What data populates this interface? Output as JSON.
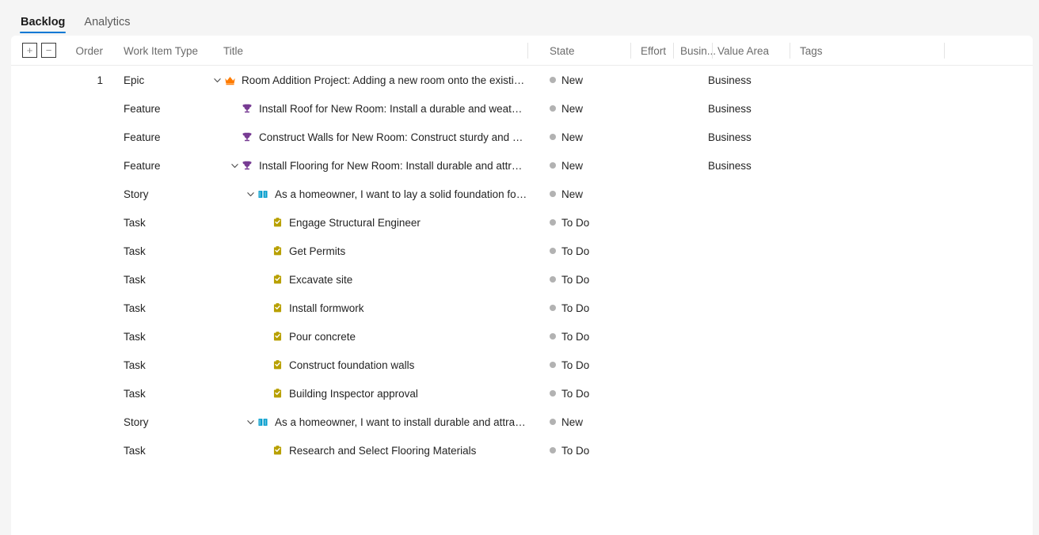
{
  "tabs": [
    {
      "label": "Backlog",
      "active": true
    },
    {
      "label": "Analytics",
      "active": false
    }
  ],
  "toolbar": {
    "expand_all_label": "+",
    "collapse_all_label": "−"
  },
  "columns": [
    {
      "key": "order",
      "label": "Order"
    },
    {
      "key": "type",
      "label": "Work Item Type"
    },
    {
      "key": "title",
      "label": "Title"
    },
    {
      "key": "state",
      "label": "State"
    },
    {
      "key": "effort",
      "label": "Effort"
    },
    {
      "key": "biz",
      "label": "Busin..."
    },
    {
      "key": "value",
      "label": "Value Area"
    },
    {
      "key": "tags",
      "label": "Tags"
    }
  ],
  "colors": {
    "accent": "#0078d4",
    "epic": "#ff7b00",
    "feature": "#773b93",
    "story": "#009ccc",
    "task": "#b8a000",
    "state_dot": "#b2b2b2"
  },
  "rows": [
    {
      "order": "1",
      "type": "Epic",
      "icon": "crown-icon",
      "indent": 0,
      "chevron": "down",
      "title": "Room Addition Project: Adding a new room onto the existin...",
      "state": "New",
      "effort": "",
      "biz": "",
      "value": "Business",
      "tags": ""
    },
    {
      "order": "",
      "type": "Feature",
      "icon": "trophy-icon",
      "indent": 1,
      "chevron": "none",
      "title": "Install Roof for New Room: Install a durable and weather...",
      "state": "New",
      "effort": "",
      "biz": "",
      "value": "Business",
      "tags": ""
    },
    {
      "order": "",
      "type": "Feature",
      "icon": "trophy-icon",
      "indent": 1,
      "chevron": "none",
      "title": "Construct Walls for New Room: Construct sturdy and wel...",
      "state": "New",
      "effort": "",
      "biz": "",
      "value": "Business",
      "tags": ""
    },
    {
      "order": "",
      "type": "Feature",
      "icon": "trophy-icon",
      "indent": 1,
      "chevron": "down",
      "title": "Install Flooring for New Room: Install durable and attracti...",
      "state": "New",
      "effort": "",
      "biz": "",
      "value": "Business",
      "tags": ""
    },
    {
      "order": "",
      "type": "Story",
      "icon": "book-icon",
      "indent": 2,
      "chevron": "down",
      "title": "As a homeowner, I want to lay a solid foundation for t...",
      "state": "New",
      "effort": "",
      "biz": "",
      "value": "",
      "tags": ""
    },
    {
      "order": "",
      "type": "Task",
      "icon": "clipboard-icon",
      "indent": 3,
      "chevron": "none",
      "title": "Engage Structural Engineer",
      "state": "To Do",
      "effort": "",
      "biz": "",
      "value": "",
      "tags": ""
    },
    {
      "order": "",
      "type": "Task",
      "icon": "clipboard-icon",
      "indent": 3,
      "chevron": "none",
      "title": "Get Permits",
      "state": "To Do",
      "effort": "",
      "biz": "",
      "value": "",
      "tags": ""
    },
    {
      "order": "",
      "type": "Task",
      "icon": "clipboard-icon",
      "indent": 3,
      "chevron": "none",
      "title": "Excavate site",
      "state": "To Do",
      "effort": "",
      "biz": "",
      "value": "",
      "tags": ""
    },
    {
      "order": "",
      "type": "Task",
      "icon": "clipboard-icon",
      "indent": 3,
      "chevron": "none",
      "title": "Install formwork",
      "state": "To Do",
      "effort": "",
      "biz": "",
      "value": "",
      "tags": ""
    },
    {
      "order": "",
      "type": "Task",
      "icon": "clipboard-icon",
      "indent": 3,
      "chevron": "none",
      "title": "Pour concrete",
      "state": "To Do",
      "effort": "",
      "biz": "",
      "value": "",
      "tags": ""
    },
    {
      "order": "",
      "type": "Task",
      "icon": "clipboard-icon",
      "indent": 3,
      "chevron": "none",
      "title": "Construct foundation walls",
      "state": "To Do",
      "effort": "",
      "biz": "",
      "value": "",
      "tags": ""
    },
    {
      "order": "",
      "type": "Task",
      "icon": "clipboard-icon",
      "indent": 3,
      "chevron": "none",
      "title": "Building Inspector approval",
      "state": "To Do",
      "effort": "",
      "biz": "",
      "value": "",
      "tags": ""
    },
    {
      "order": "",
      "type": "Story",
      "icon": "book-icon",
      "indent": 2,
      "chevron": "down",
      "title": "As a homeowner, I want to install durable and attracti...",
      "state": "New",
      "effort": "",
      "biz": "",
      "value": "",
      "tags": ""
    },
    {
      "order": "",
      "type": "Task",
      "icon": "clipboard-icon",
      "indent": 3,
      "chevron": "none",
      "title": "Research and Select Flooring Materials",
      "state": "To Do",
      "effort": "",
      "biz": "",
      "value": "",
      "tags": ""
    }
  ]
}
